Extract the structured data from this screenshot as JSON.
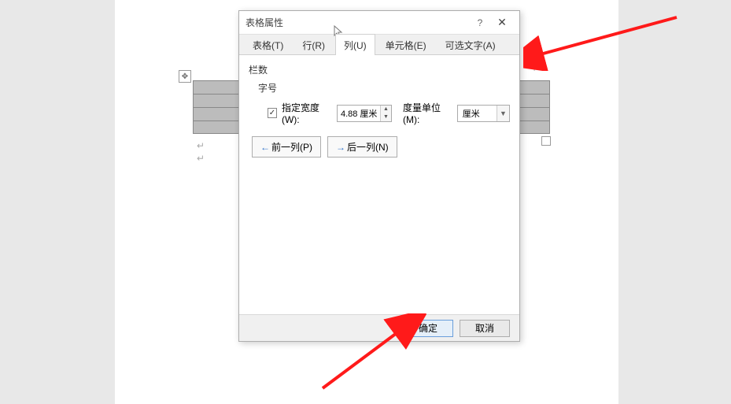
{
  "dialog": {
    "title": "表格属性",
    "help": "?",
    "close": "✕",
    "tabs": {
      "table": "表格(T)",
      "row": "行(R)",
      "column": "列(U)",
      "cell": "单元格(E)",
      "alt": "可选文字(A)"
    },
    "group_label": "栏数",
    "sub_label": "字号",
    "specify_width_label": "指定宽度(W):",
    "width_value": "4.88 厘米",
    "unit_label": "度量单位(M):",
    "unit_value": "厘米",
    "prev_col": "前一列(P)",
    "next_col": "后一列(N)",
    "ok": "确定",
    "cancel": "取消"
  }
}
